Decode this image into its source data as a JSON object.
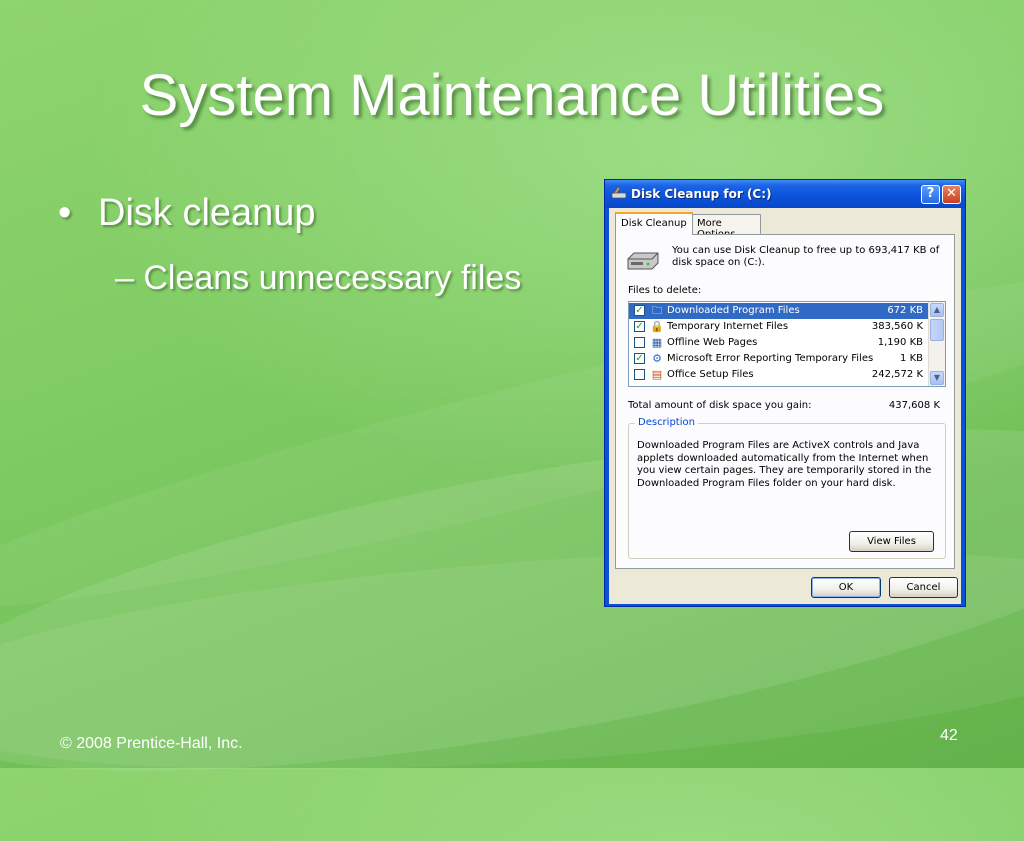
{
  "slide": {
    "title": "System Maintenance Utilities",
    "bullet_1": "Disk cleanup",
    "bullet_2": "– Cleans unnecessary files",
    "bullet_marker": "•",
    "footer": "© 2008 Prentice-Hall, Inc.",
    "page_number": "42"
  },
  "dialog": {
    "title": "Disk Cleanup for  (C:)",
    "help_button": "?",
    "close_button": "✕",
    "tabs": [
      {
        "label": "Disk Cleanup",
        "active": true
      },
      {
        "label": "More Options",
        "active": false
      }
    ],
    "intro_text": "You can use Disk Cleanup to free up to 693,417 KB of disk space on  (C:).",
    "files_label": "Files to delete:",
    "files": [
      {
        "name": "Downloaded Program Files",
        "size": "672 KB",
        "checked": true,
        "selected": true,
        "icon": "folder-icon",
        "glyph": "🗀"
      },
      {
        "name": "Temporary Internet Files",
        "size": "383,560 K",
        "checked": true,
        "selected": false,
        "icon": "lock-icon",
        "glyph": "🔒"
      },
      {
        "name": "Offline Web Pages",
        "size": "1,190 KB",
        "checked": false,
        "selected": false,
        "icon": "web-page-icon",
        "glyph": "▦"
      },
      {
        "name": "Microsoft Error Reporting Temporary Files",
        "size": "1 KB",
        "checked": true,
        "selected": false,
        "icon": "error-report-icon",
        "glyph": "⚙"
      },
      {
        "name": "Office Setup Files",
        "size": "242,572 K",
        "checked": false,
        "selected": false,
        "icon": "office-setup-icon",
        "glyph": "▤"
      }
    ],
    "total_label": "Total amount of disk space you gain:",
    "total_value": "437,608 K",
    "description_title": "Description",
    "description_text": "Downloaded Program Files are ActiveX controls and Java applets downloaded automatically from the Internet when you view certain pages. They are temporarily stored in the Downloaded Program Files folder on your hard disk.",
    "view_files_button": "View Files",
    "ok_button": "OK",
    "cancel_button": "Cancel",
    "check_mark": "✓",
    "colors": {
      "title_bar": "#0a52dc",
      "selection": "#316ac5",
      "face": "#ece9d8",
      "active_tab_accent": "#f5a623"
    }
  }
}
